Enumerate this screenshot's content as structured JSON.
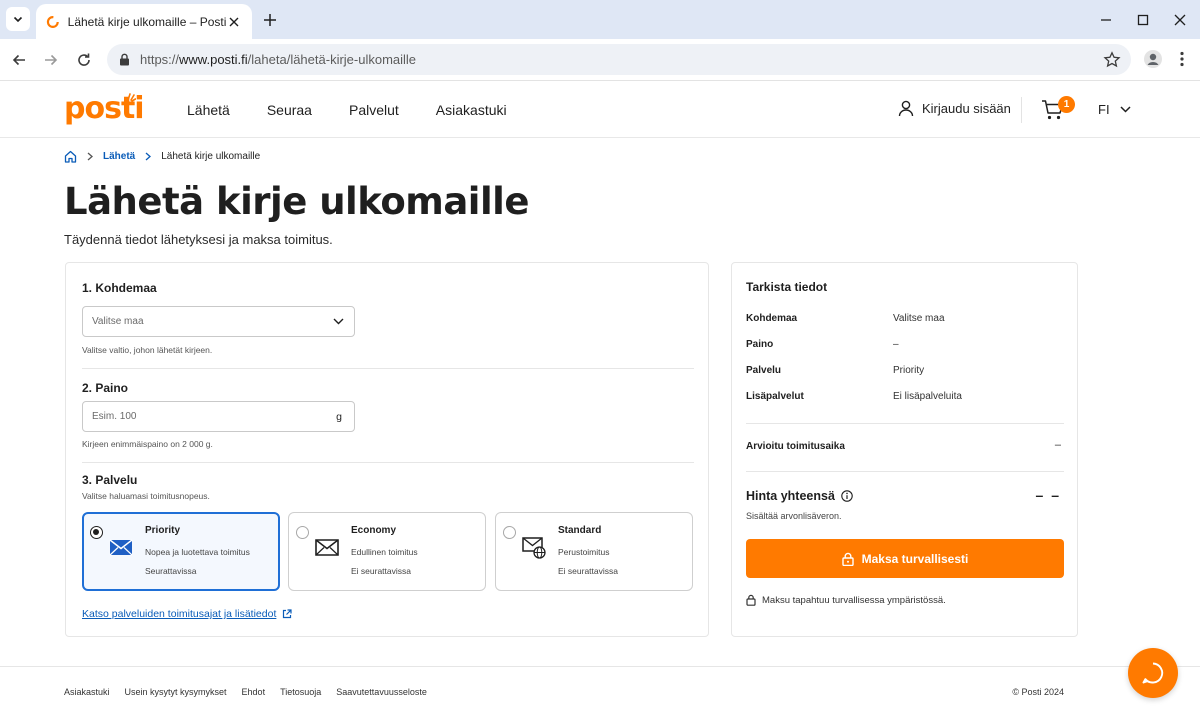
{
  "browser": {
    "tab_title": "Lähetä kirje ulkomaille – Posti",
    "url_prefix": "https://",
    "url_host": "www.posti.fi",
    "url_path": "/laheta/lähetä-kirje-ulkomaille"
  },
  "header": {
    "logo_text": "posti",
    "nav": [
      "Lähetä",
      "Seuraa",
      "Palvelut",
      "Asiakastuki"
    ],
    "login_label": "Kirjaudu sisään",
    "cart_count": "1",
    "language": "FI"
  },
  "breadcrumb": {
    "parent": "Lähetä",
    "current": "Lähetä kirje ulkomaille"
  },
  "page": {
    "title": "Lähetä kirje ulkomaille",
    "subtitle": "Täydennä tiedot lähetyksesi ja maksa toimitus."
  },
  "form": {
    "destination": {
      "title": "1. Kohdemaa",
      "select_value": "Valitse maa",
      "helper": "Valitse valtio, johon lähetät kirjeen."
    },
    "weight": {
      "title": "2. Paino",
      "placeholder": "Esim. 100",
      "unit": "g",
      "helper": "Kirjeen enimmäispaino on 2 000 g."
    },
    "service": {
      "title": "3. Palvelu",
      "helper": "Valitse haluamasi toimitusnopeus.",
      "options": [
        {
          "name": "Priority",
          "line1": "Nopea ja luotettava toimitus",
          "line2": "Seurattavissa",
          "icon": "envelope-fast-icon",
          "selected": true
        },
        {
          "name": "Economy",
          "line1": "Edullinen toimitus",
          "line2": "Ei seurattavissa",
          "icon": "envelope-icon",
          "selected": false
        },
        {
          "name": "Standard",
          "line1": "Perustoimitus",
          "line2": "Ei seurattavissa",
          "icon": "envelope-globe-icon",
          "selected": false
        }
      ]
    },
    "more_link": "Katso palveluiden toimitusajat ja lisätiedot"
  },
  "summary": {
    "title": "Tarkista tiedot",
    "rows": [
      {
        "label": "Kohdemaa",
        "value": "Valitse maa"
      },
      {
        "label": "Paino",
        "value": "–"
      },
      {
        "label": "Palvelu",
        "value": "Priority"
      },
      {
        "label": "Lisäpalvelut",
        "value": "Ei lisäpalveluita"
      }
    ],
    "eta_label": "Arvioitu toimitusaika",
    "eta_value": "–",
    "price_label": "Hinta yhteensä",
    "price_value": "– –",
    "vat_note": "Sisältää arvonlisäveron.",
    "pay_button": "Maksa turvallisesti",
    "secure_note": "Maksu tapahtuu turvallisessa ympäristössä."
  },
  "footer": {
    "links": [
      "Asiakastuki",
      "Usein kysytyt kysymykset",
      "Ehdot",
      "Tietosuoja",
      "Saavutettavuusseloste"
    ],
    "copyright": "© Posti 2024"
  },
  "colors": {
    "brand_orange": "#ff7a00",
    "link_blue": "#0a5cb8",
    "selected_blue": "#1f6fd6"
  }
}
